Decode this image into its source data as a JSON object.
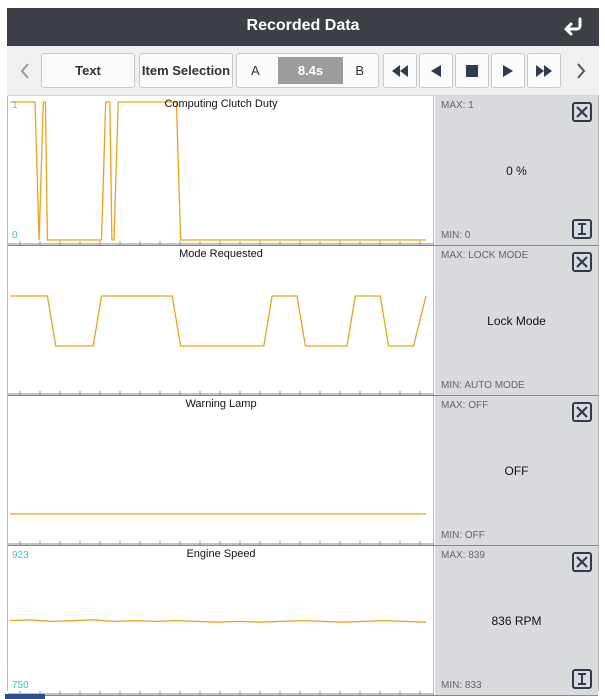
{
  "header": {
    "title": "Recorded Data",
    "back_icon": "return-arrow-icon"
  },
  "toolbar": {
    "text_label": "Text",
    "item_selection_label": "Item Selection",
    "marker_a": "A",
    "marker_b": "B",
    "time_value": "8.4s"
  },
  "colors": {
    "trace": "#f0a020",
    "axis_label": "#38c6cf",
    "header_bg": "#3c3f45",
    "info_bg": "#d9dade"
  },
  "panels": [
    {
      "title": "Computing Clutch Duty",
      "y_max_label": "1",
      "y_min_label": "0",
      "max": "MAX: 1",
      "min": "MIN: 0",
      "current": "0 %",
      "has_info_button": true
    },
    {
      "title": "Mode Requested",
      "y_max_label": "",
      "y_min_label": "",
      "max": "MAX: LOCK MODE",
      "min": "MIN: AUTO MODE",
      "current": "Lock Mode",
      "has_info_button": false
    },
    {
      "title": "Warning Lamp",
      "y_max_label": "",
      "y_min_label": "",
      "max": "MAX: OFF",
      "min": "MIN: OFF",
      "current": "OFF",
      "has_info_button": false
    },
    {
      "title": "Engine Speed",
      "y_max_label": "923",
      "y_min_label": "750",
      "max": "MAX: 839",
      "min": "MIN: 833",
      "current": "836 RPM",
      "has_info_button": true
    }
  ],
  "chart_data": [
    {
      "type": "line",
      "title": "Computing Clutch Duty",
      "ylim": [
        0,
        1
      ],
      "x": [
        0,
        0.06,
        0.07,
        0.08,
        0.085,
        0.09,
        0.1,
        0.22,
        0.23,
        0.24,
        0.245,
        0.25,
        0.26,
        0.27,
        0.32,
        0.33,
        0.4,
        0.41,
        1.0
      ],
      "y": [
        1,
        1,
        0,
        1,
        1,
        0,
        0,
        0,
        1,
        1,
        0,
        0,
        1,
        1,
        1,
        1,
        1,
        0,
        0
      ]
    },
    {
      "type": "line",
      "title": "Mode Requested",
      "categories_y": [
        "AUTO MODE",
        "LOCK MODE"
      ],
      "x": [
        0,
        0.09,
        0.11,
        0.2,
        0.22,
        0.39,
        0.41,
        0.61,
        0.63,
        0.69,
        0.71,
        0.81,
        0.83,
        0.89,
        0.91,
        0.97,
        1.0
      ],
      "y": [
        1,
        1,
        0,
        0,
        1,
        1,
        0,
        0,
        1,
        1,
        0,
        0,
        1,
        1,
        0,
        0,
        1
      ]
    },
    {
      "type": "line",
      "title": "Warning Lamp",
      "x": [
        0,
        1
      ],
      "y": [
        0,
        0
      ]
    },
    {
      "type": "line",
      "title": "Engine Speed",
      "ylim": [
        750,
        923
      ],
      "x": [
        0,
        0.05,
        0.1,
        0.15,
        0.2,
        0.25,
        0.3,
        0.35,
        0.4,
        0.45,
        0.5,
        0.55,
        0.6,
        0.65,
        0.7,
        0.75,
        0.8,
        0.85,
        0.9,
        0.95,
        1.0
      ],
      "y": [
        837,
        838,
        836,
        837,
        838,
        836,
        837,
        836,
        837,
        836,
        835,
        836,
        835,
        836,
        837,
        836,
        835,
        836,
        837,
        836,
        835
      ]
    }
  ]
}
